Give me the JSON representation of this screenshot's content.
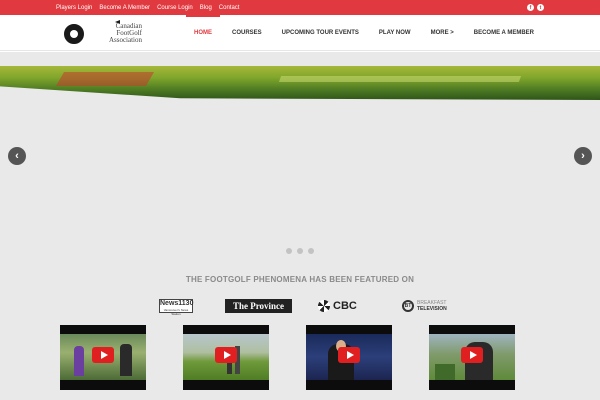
{
  "topbar": {
    "links": [
      "Players Login",
      "Become A Member",
      "Course Login",
      "Blog",
      "Contact"
    ],
    "social": [
      {
        "icon": "facebook-icon",
        "glyph": "f"
      },
      {
        "icon": "twitter-icon",
        "glyph": "t"
      }
    ]
  },
  "header": {
    "logo_lines": [
      "Canadian",
      "FootGolf",
      "Association"
    ],
    "nav": [
      {
        "label": "HOME",
        "active": true
      },
      {
        "label": "COURSES",
        "active": false
      },
      {
        "label": "UPCOMING TOUR EVENTS",
        "active": false
      },
      {
        "label": "PLAY NOW",
        "active": false
      },
      {
        "label": "MORE >",
        "active": false
      },
      {
        "label": "BECOME A MEMBER",
        "active": false
      }
    ]
  },
  "slider": {
    "prev_glyph": "‹",
    "next_glyph": "›",
    "dot_count": 3
  },
  "featured": {
    "title": "THE FOOTGOLF PHENOMENA HAS BEEN FEATURED ON",
    "media": {
      "news1130": {
        "name": "News1130",
        "tagline": "Vancouver's News Station"
      },
      "province": {
        "name": "The Province"
      },
      "cbc": {
        "name": "CBC"
      },
      "bt": {
        "mark": "BT",
        "line1": "BREAKFAST",
        "line2": "TELEVISION"
      }
    },
    "videos": [
      {
        "icon": "play-icon"
      },
      {
        "icon": "play-icon"
      },
      {
        "icon": "play-icon"
      },
      {
        "icon": "play-icon"
      }
    ]
  },
  "colors": {
    "brand_red": "#e0393f",
    "background_gray": "#e9e9e9",
    "nav_text": "#333333"
  }
}
